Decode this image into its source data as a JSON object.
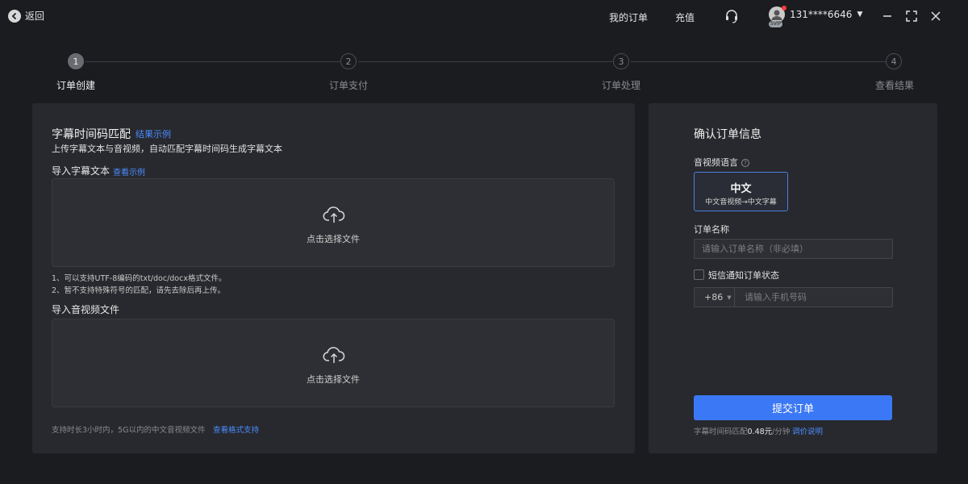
{
  "titlebar": {
    "back_label": "返回",
    "my_orders": "我的订单",
    "recharge": "充值",
    "user_phone": "131****6646",
    "vip_badge": "SVIP"
  },
  "steps": [
    {
      "num": "1",
      "label": "订单创建",
      "active": true
    },
    {
      "num": "2",
      "label": "订单支付",
      "active": false
    },
    {
      "num": "3",
      "label": "订单处理",
      "active": false
    },
    {
      "num": "4",
      "label": "查看结果",
      "active": false
    }
  ],
  "left": {
    "title": "字幕时间码匹配",
    "title_link": "结果示例",
    "description": "上传字幕文本与音视频，自动匹配字幕时间码生成字幕文本",
    "text_section": {
      "title": "导入字幕文本",
      "link": "查看示例",
      "upload_text": "点击选择文件",
      "notes": [
        "1、可以支持UTF-8编码的txt/doc/docx格式文件。",
        "2、暂不支持特殊符号的匹配，请先去除后再上传。"
      ]
    },
    "media_section": {
      "title": "导入音视频文件",
      "upload_text": "点击选择文件"
    },
    "footnote": "支持时长3小时内，5G以内的中文音视频文件",
    "footnote_link": "查看格式支持"
  },
  "right": {
    "title": "确认订单信息",
    "lang_label": "音视频语言",
    "lang_help": "?",
    "lang_card": {
      "title": "中文",
      "subtitle": "中文音视频→中文字幕"
    },
    "order_name_label": "订单名称",
    "order_name_placeholder": "请输入订单名称（非必填）",
    "sms_label": "短信通知订单状态",
    "country_code": "+86",
    "phone_placeholder": "请输入手机号码",
    "submit_label": "提交订单",
    "price_prefix": "字幕时间码匹配",
    "price_value": "0.48元",
    "price_suffix": "/分钟",
    "price_link": "调价说明"
  },
  "colors": {
    "accent": "#3b78f5",
    "link": "#4a8cff",
    "panel": "#28292e",
    "background": "#1b1c20"
  }
}
